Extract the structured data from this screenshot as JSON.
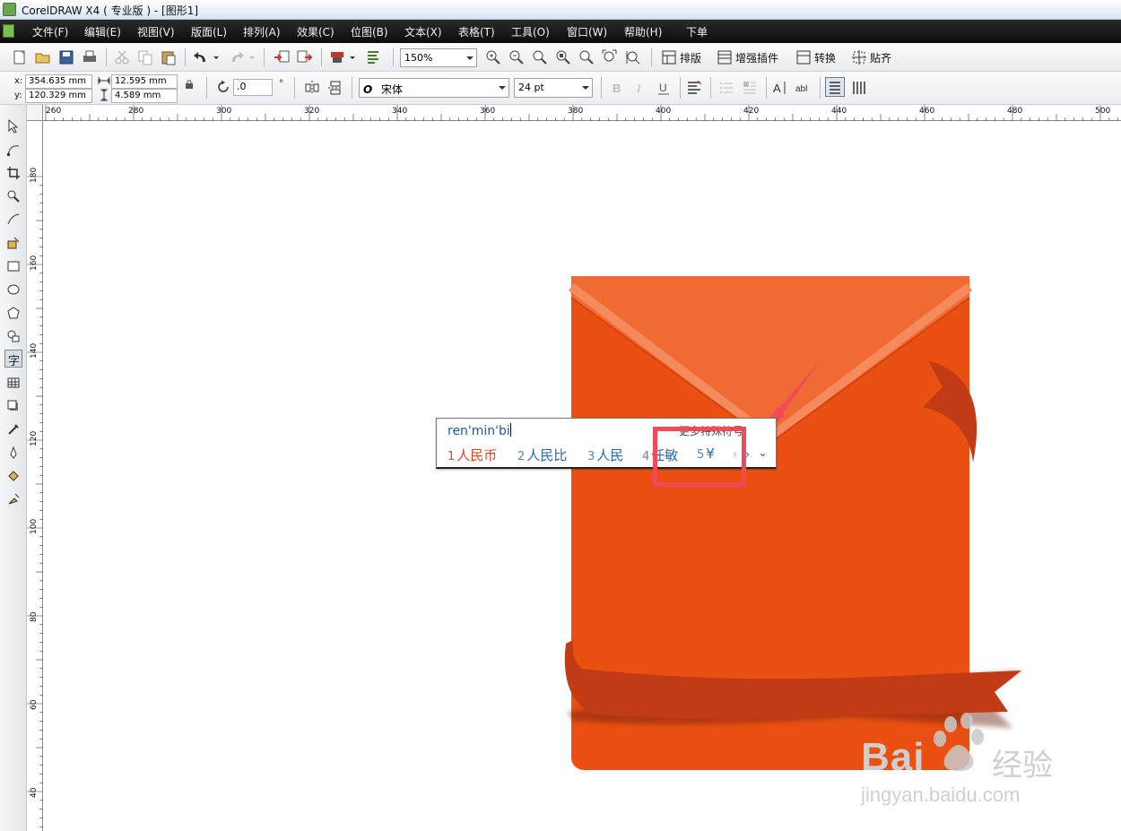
{
  "window": {
    "title": "CorelDRAW X4 ( 专业版 ) - [图形1]"
  },
  "menu": [
    {
      "label": "文件(F)"
    },
    {
      "label": "编辑(E)"
    },
    {
      "label": "视图(V)"
    },
    {
      "label": "版面(L)"
    },
    {
      "label": "排列(A)"
    },
    {
      "label": "效果(C)"
    },
    {
      "label": "位图(B)"
    },
    {
      "label": "文本(X)"
    },
    {
      "label": "表格(T)"
    },
    {
      "label": "工具(O)"
    },
    {
      "label": "窗口(W)"
    },
    {
      "label": "帮助(H)"
    },
    {
      "label": "下单"
    }
  ],
  "toolbar": {
    "zoom": "150%",
    "layout_label": "排版",
    "plugin_label": "增强插件",
    "convert_label": "转换",
    "snap_label": "贴齐"
  },
  "property_bar": {
    "x_label": "x:",
    "y_label": "y:",
    "x_value": "354.635 mm",
    "y_value": "120.329 mm",
    "width_value": "12.595 mm",
    "height_value": "4.589 mm",
    "rotation_value": ".0",
    "degree_symbol": "°",
    "font_name": "宋体",
    "font_size": "24 pt",
    "font_style_glyph": "O"
  },
  "ruler": {
    "top_ticks": [
      "260",
      "280",
      "300",
      "320",
      "340",
      "360",
      "380",
      "400",
      "420",
      "440",
      "460",
      "480",
      "500"
    ],
    "left_ticks": [
      "180",
      "160",
      "140",
      "120",
      "100",
      "80",
      "60",
      "40"
    ]
  },
  "ime": {
    "composition": "ren'min'bi",
    "hint": "更多特殊符号",
    "candidates": [
      {
        "num": "1",
        "text": "人民币"
      },
      {
        "num": "2",
        "text": "人民比"
      },
      {
        "num": "3",
        "text": "人民"
      },
      {
        "num": "4",
        "text": "任敏"
      },
      {
        "num": "5",
        "text": "¥"
      }
    ]
  },
  "watermark": {
    "brand": "Bai",
    "brand_suffix": "经验",
    "url": "jingyan.baidu.com"
  },
  "colors": {
    "envelope_body": "#ea5012",
    "envelope_flap": "#f06a34",
    "ribbon": "#c13b17",
    "highlight": "#f24a58"
  }
}
